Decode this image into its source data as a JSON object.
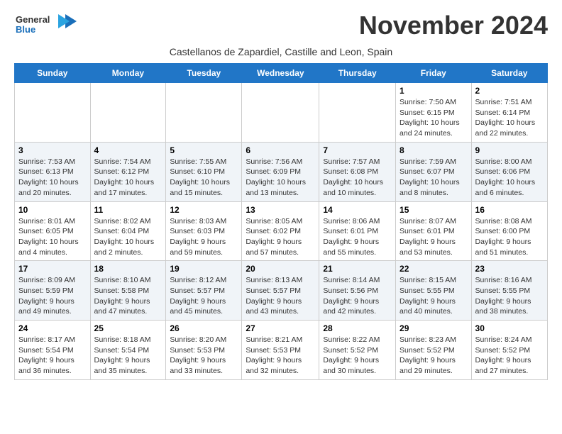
{
  "logo": {
    "line1": "General",
    "line2": "Blue"
  },
  "title": "November 2024",
  "subtitle": "Castellanos de Zapardiel, Castille and Leon, Spain",
  "days_of_week": [
    "Sunday",
    "Monday",
    "Tuesday",
    "Wednesday",
    "Thursday",
    "Friday",
    "Saturday"
  ],
  "weeks": [
    [
      {
        "day": "",
        "info": ""
      },
      {
        "day": "",
        "info": ""
      },
      {
        "day": "",
        "info": ""
      },
      {
        "day": "",
        "info": ""
      },
      {
        "day": "",
        "info": ""
      },
      {
        "day": "1",
        "info": "Sunrise: 7:50 AM\nSunset: 6:15 PM\nDaylight: 10 hours and 24 minutes."
      },
      {
        "day": "2",
        "info": "Sunrise: 7:51 AM\nSunset: 6:14 PM\nDaylight: 10 hours and 22 minutes."
      }
    ],
    [
      {
        "day": "3",
        "info": "Sunrise: 7:53 AM\nSunset: 6:13 PM\nDaylight: 10 hours and 20 minutes."
      },
      {
        "day": "4",
        "info": "Sunrise: 7:54 AM\nSunset: 6:12 PM\nDaylight: 10 hours and 17 minutes."
      },
      {
        "day": "5",
        "info": "Sunrise: 7:55 AM\nSunset: 6:10 PM\nDaylight: 10 hours and 15 minutes."
      },
      {
        "day": "6",
        "info": "Sunrise: 7:56 AM\nSunset: 6:09 PM\nDaylight: 10 hours and 13 minutes."
      },
      {
        "day": "7",
        "info": "Sunrise: 7:57 AM\nSunset: 6:08 PM\nDaylight: 10 hours and 10 minutes."
      },
      {
        "day": "8",
        "info": "Sunrise: 7:59 AM\nSunset: 6:07 PM\nDaylight: 10 hours and 8 minutes."
      },
      {
        "day": "9",
        "info": "Sunrise: 8:00 AM\nSunset: 6:06 PM\nDaylight: 10 hours and 6 minutes."
      }
    ],
    [
      {
        "day": "10",
        "info": "Sunrise: 8:01 AM\nSunset: 6:05 PM\nDaylight: 10 hours and 4 minutes."
      },
      {
        "day": "11",
        "info": "Sunrise: 8:02 AM\nSunset: 6:04 PM\nDaylight: 10 hours and 2 minutes."
      },
      {
        "day": "12",
        "info": "Sunrise: 8:03 AM\nSunset: 6:03 PM\nDaylight: 9 hours and 59 minutes."
      },
      {
        "day": "13",
        "info": "Sunrise: 8:05 AM\nSunset: 6:02 PM\nDaylight: 9 hours and 57 minutes."
      },
      {
        "day": "14",
        "info": "Sunrise: 8:06 AM\nSunset: 6:01 PM\nDaylight: 9 hours and 55 minutes."
      },
      {
        "day": "15",
        "info": "Sunrise: 8:07 AM\nSunset: 6:01 PM\nDaylight: 9 hours and 53 minutes."
      },
      {
        "day": "16",
        "info": "Sunrise: 8:08 AM\nSunset: 6:00 PM\nDaylight: 9 hours and 51 minutes."
      }
    ],
    [
      {
        "day": "17",
        "info": "Sunrise: 8:09 AM\nSunset: 5:59 PM\nDaylight: 9 hours and 49 minutes."
      },
      {
        "day": "18",
        "info": "Sunrise: 8:10 AM\nSunset: 5:58 PM\nDaylight: 9 hours and 47 minutes."
      },
      {
        "day": "19",
        "info": "Sunrise: 8:12 AM\nSunset: 5:57 PM\nDaylight: 9 hours and 45 minutes."
      },
      {
        "day": "20",
        "info": "Sunrise: 8:13 AM\nSunset: 5:57 PM\nDaylight: 9 hours and 43 minutes."
      },
      {
        "day": "21",
        "info": "Sunrise: 8:14 AM\nSunset: 5:56 PM\nDaylight: 9 hours and 42 minutes."
      },
      {
        "day": "22",
        "info": "Sunrise: 8:15 AM\nSunset: 5:55 PM\nDaylight: 9 hours and 40 minutes."
      },
      {
        "day": "23",
        "info": "Sunrise: 8:16 AM\nSunset: 5:55 PM\nDaylight: 9 hours and 38 minutes."
      }
    ],
    [
      {
        "day": "24",
        "info": "Sunrise: 8:17 AM\nSunset: 5:54 PM\nDaylight: 9 hours and 36 minutes."
      },
      {
        "day": "25",
        "info": "Sunrise: 8:18 AM\nSunset: 5:54 PM\nDaylight: 9 hours and 35 minutes."
      },
      {
        "day": "26",
        "info": "Sunrise: 8:20 AM\nSunset: 5:53 PM\nDaylight: 9 hours and 33 minutes."
      },
      {
        "day": "27",
        "info": "Sunrise: 8:21 AM\nSunset: 5:53 PM\nDaylight: 9 hours and 32 minutes."
      },
      {
        "day": "28",
        "info": "Sunrise: 8:22 AM\nSunset: 5:52 PM\nDaylight: 9 hours and 30 minutes."
      },
      {
        "day": "29",
        "info": "Sunrise: 8:23 AM\nSunset: 5:52 PM\nDaylight: 9 hours and 29 minutes."
      },
      {
        "day": "30",
        "info": "Sunrise: 8:24 AM\nSunset: 5:52 PM\nDaylight: 9 hours and 27 minutes."
      }
    ]
  ]
}
